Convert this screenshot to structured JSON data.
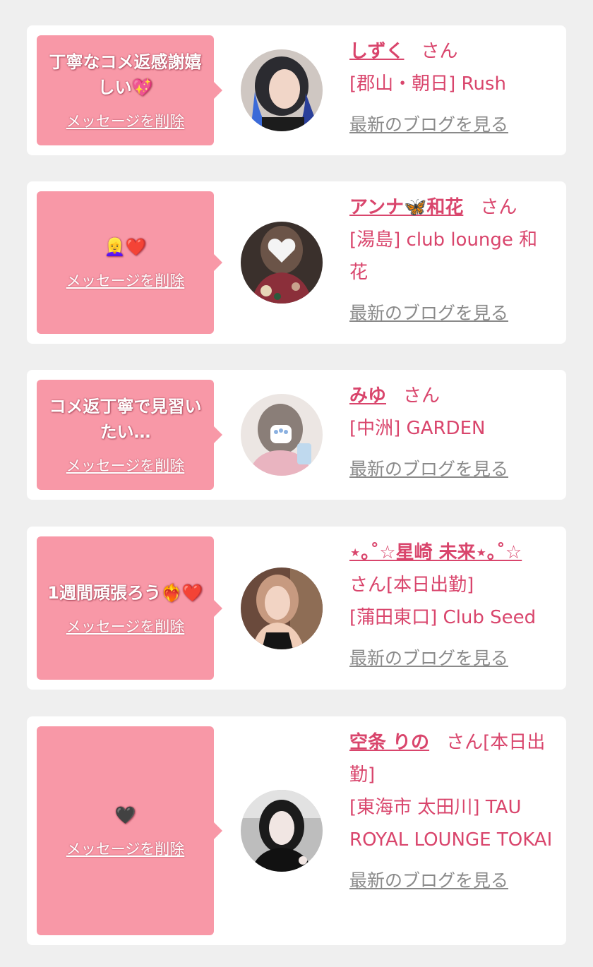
{
  "delete_label": "メッセージを削除",
  "blog_label": "最新のブログを見る",
  "colors": {
    "bubble": "#f898a7",
    "accent": "#d9456c",
    "link_gray": "#8a8a8a",
    "background": "#efefef"
  },
  "items": [
    {
      "message": "丁寧なコメ返感謝嬉しい💖",
      "name": "しずく",
      "honorific": "さん",
      "shop": "[郡山・朝日] Rush",
      "avatar_icon": "profile-photo"
    },
    {
      "message": "👱‍♀️❤️",
      "name": "アンナ🦋和花",
      "honorific": "さん",
      "shop": "[湯島] club lounge 和花",
      "avatar_icon": "profile-photo"
    },
    {
      "message": "コメ返丁寧で見習いたい…",
      "name": "みゆ",
      "honorific": "さん",
      "shop": "[中洲] GARDEN",
      "avatar_icon": "profile-photo"
    },
    {
      "message": "1週間頑張ろう❤️‍🔥❤️",
      "name": "⋆｡˚☆星崎 未来⋆｡˚☆",
      "honorific": "さん[本日出勤]",
      "shop": "[蒲田東口] Club Seed",
      "avatar_icon": "profile-photo"
    },
    {
      "message": "🖤",
      "name": "空条 りの",
      "honorific": "さん[本日出勤]",
      "shop": "[東海市 太田川] TAU ROYAL LOUNGE TOKAI",
      "avatar_icon": "profile-photo"
    }
  ]
}
